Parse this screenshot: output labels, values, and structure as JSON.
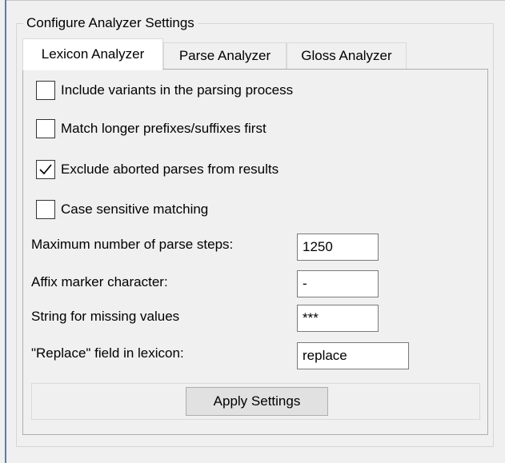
{
  "group_title": "Configure Analyzer Settings",
  "tabs": [
    {
      "label": "Lexicon Analyzer",
      "active": true
    },
    {
      "label": "Parse Analyzer",
      "active": false
    },
    {
      "label": "Gloss Analyzer",
      "active": false
    }
  ],
  "options": [
    {
      "label": "Include variants in the parsing process",
      "checked": false
    },
    {
      "label": "Match longer prefixes/suffixes first",
      "checked": false
    },
    {
      "label": "Exclude aborted parses from results",
      "checked": true
    },
    {
      "label": "Case sensitive matching",
      "checked": false
    }
  ],
  "fields": [
    {
      "label": "Maximum number of parse steps:",
      "value": "1250"
    },
    {
      "label": "Affix marker character:",
      "value": "-"
    },
    {
      "label": "String for missing values",
      "value": "***"
    },
    {
      "label": "\"Replace\" field in lexicon:",
      "value": "replace"
    }
  ],
  "apply_label": "Apply Settings"
}
